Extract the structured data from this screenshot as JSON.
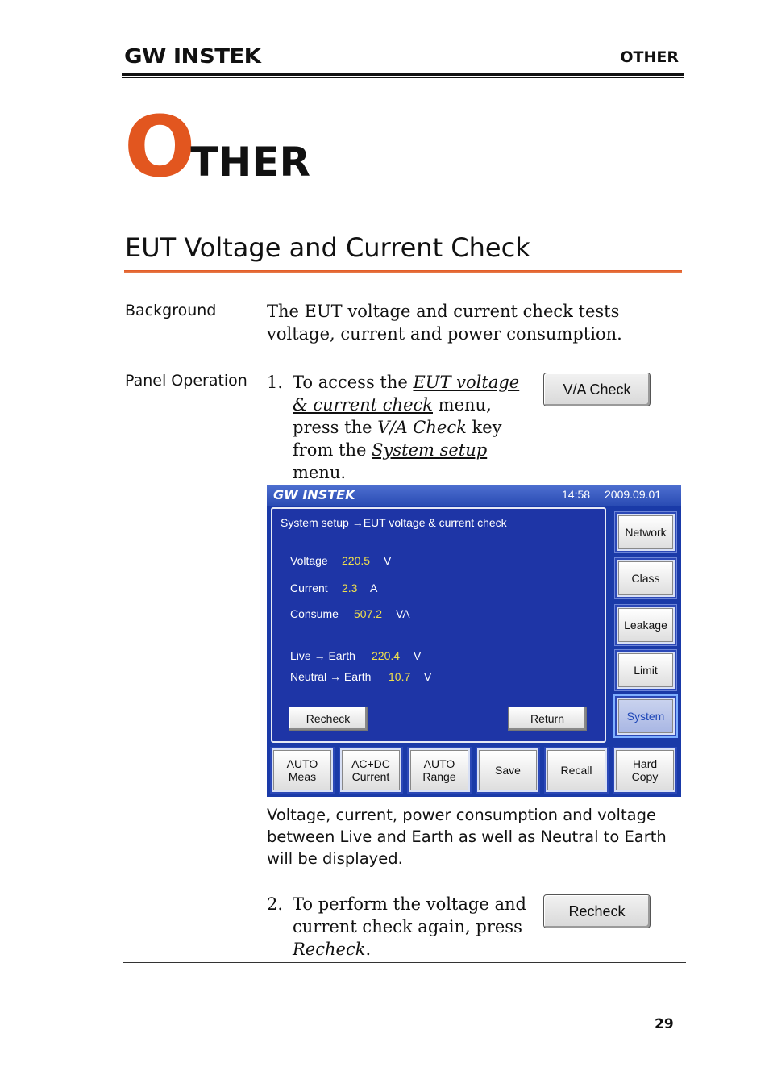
{
  "header": {
    "brand": "GW INSTEK",
    "section": "OTHER"
  },
  "chapter": {
    "initial": "O",
    "rest": "THER"
  },
  "section_title": "EUT Voltage and Current Check",
  "background": {
    "label": "Background",
    "text": "The EUT voltage and current check tests voltage, current and power consumption."
  },
  "panel_operation": {
    "label": "Panel Operation",
    "step1": {
      "num": "1.",
      "pre": "To access the ",
      "link1": "EUT voltage & current check",
      "mid1": " menu, press the ",
      "key": "V/A Check",
      "mid2": " key from the ",
      "link2": "System setup",
      "post": " menu.",
      "button_label": "V/A Check"
    },
    "caption": "Voltage, current, power consumption and voltage between Live and Earth as well as Neutral to Earth will be displayed.",
    "step2": {
      "num": "2.",
      "pre": "To perform the voltage and current check again, press ",
      "key": "Recheck",
      "post": ".",
      "button_label": "Recheck"
    }
  },
  "device_screen": {
    "logo": "GW INSTEK",
    "time": "14:58",
    "date": "2009.09.01",
    "breadcrumb": "System setup →EUT voltage & current check",
    "readings": [
      {
        "label": "Voltage",
        "value": "220.5",
        "unit": "V"
      },
      {
        "label": "Current",
        "value": "2.3",
        "unit": "A"
      },
      {
        "label": "Consume",
        "value": "507.2",
        "unit": "VA"
      },
      {
        "label": "Live → Earth",
        "value": "220.4",
        "unit": "V"
      },
      {
        "label": "Neutral → Earth",
        "value": "10.7",
        "unit": "V"
      }
    ],
    "recheck_label": "Recheck",
    "return_label": "Return",
    "side_menu": [
      "Network",
      "Class",
      "Leakage",
      "Limit",
      "System"
    ],
    "active_side": "System",
    "bottom_menu": [
      "AUTO\nMeas",
      "AC+DC\nCurrent",
      "AUTO\nRange",
      "Save",
      "Recall",
      "Hard\nCopy"
    ]
  },
  "page_number": "29"
}
